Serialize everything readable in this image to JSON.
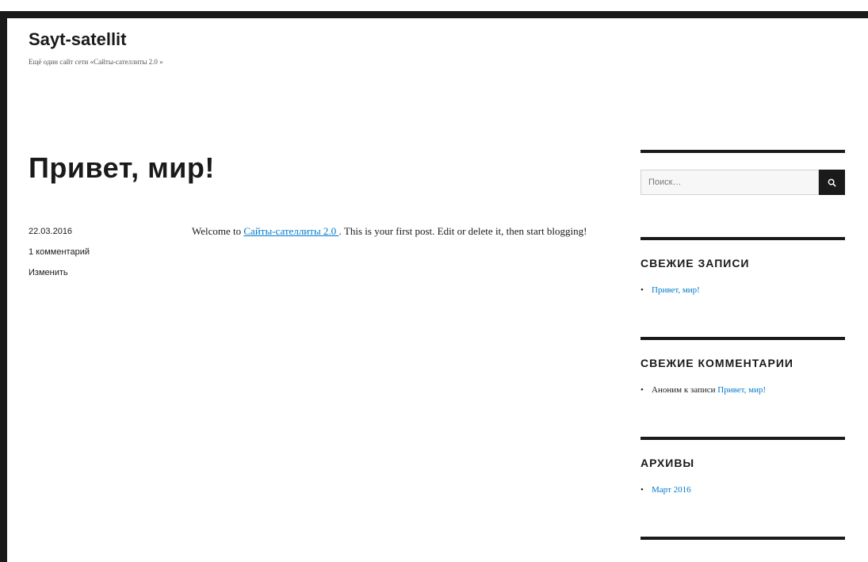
{
  "site": {
    "title": "Sayt-satellit",
    "description": "Ещё один сайт сети «Сайты-сателлиты 2.0 »"
  },
  "post": {
    "title": "Привет, мир!",
    "date": "22.03.2016",
    "comments": "1 комментарий",
    "edit": "Изменить",
    "content_before": "Welcome to ",
    "content_link": "Сайты-сателлиты 2.0 ",
    "content_after": ". This is your first post. Edit or delete it, then start blogging!"
  },
  "sidebar": {
    "search": {
      "placeholder": "Поиск…",
      "button_icon": "search-icon"
    },
    "recent_posts": {
      "title": "СВЕЖИЕ ЗАПИСИ",
      "items": [
        "Привет, мир!"
      ]
    },
    "recent_comments": {
      "title": "СВЕЖИЕ КОММЕНТАРИИ",
      "items": [
        {
          "author": "Аноним к записи ",
          "post": "Привет, мир!"
        }
      ]
    },
    "archives": {
      "title": "АРХИВЫ",
      "items": [
        "Март 2016"
      ]
    }
  },
  "colors": {
    "text": "#1a1a1a",
    "link": "#007acc",
    "frame": "#1a1a1a"
  }
}
